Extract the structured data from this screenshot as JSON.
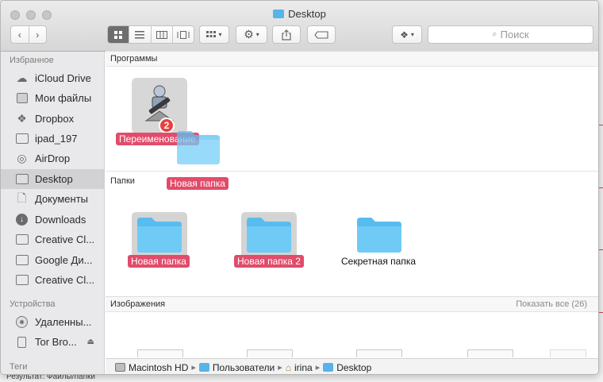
{
  "window": {
    "title": "Desktop"
  },
  "background": {
    "bottom_text": "Результат: Файлы/папки"
  },
  "toolbar": {
    "search_placeholder": "Поиск",
    "accent_color": "#56b4e9"
  },
  "sidebar": {
    "favorites_header": "Избранное",
    "favorites": [
      {
        "label": "iCloud Drive",
        "icon": "cloud-icon"
      },
      {
        "label": "Мои файлы",
        "icon": "all-files-icon"
      },
      {
        "label": "Dropbox",
        "icon": "dropbox-icon"
      },
      {
        "label": "ipad_197",
        "icon": "folder-icon"
      },
      {
        "label": "AirDrop",
        "icon": "airdrop-icon"
      },
      {
        "label": "Desktop",
        "icon": "desktop-icon",
        "selected": true
      },
      {
        "label": "Документы",
        "icon": "documents-icon"
      },
      {
        "label": "Downloads",
        "icon": "downloads-icon"
      },
      {
        "label": "Creative Cl...",
        "icon": "folder-icon"
      },
      {
        "label": "Google Ди...",
        "icon": "folder-icon"
      },
      {
        "label": "Creative Cl...",
        "icon": "folder-icon"
      }
    ],
    "devices_header": "Устройства",
    "devices": [
      {
        "label": "Удаленны...",
        "icon": "disc-icon"
      },
      {
        "label": "Tor Bro...",
        "icon": "disk-icon",
        "ejectable": true
      }
    ],
    "tags_header": "Теги"
  },
  "content": {
    "apps_section": "Программы",
    "app_item_label": "Переименование",
    "app_badge": "2",
    "dragged_label": "Новая папка",
    "folders_section": "Папки",
    "folders": [
      {
        "label": "Новая папка",
        "tagged": true
      },
      {
        "label": "Новая папка 2",
        "tagged": true
      },
      {
        "label": "Секретная папка",
        "tagged": false
      }
    ],
    "images_section": "Изображения",
    "images_show_all": "Показать все (26)",
    "tag_color": "#e14c6b"
  },
  "pathbar": {
    "items": [
      "Macintosh HD",
      "Пользователи",
      "irina",
      "Desktop"
    ]
  }
}
